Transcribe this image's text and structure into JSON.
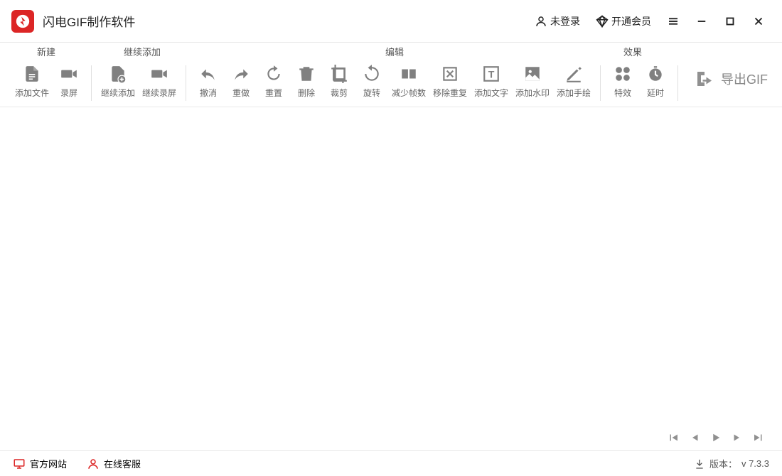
{
  "app": {
    "title": "闪电GIF制作软件"
  },
  "titlebar": {
    "login": "未登录",
    "vip": "开通会员"
  },
  "toolbar": {
    "headers": {
      "new": "新建",
      "continue": "继续添加",
      "edit": "编辑",
      "effect": "效果"
    },
    "new": {
      "addFile": "添加文件",
      "recordScreen": "录屏"
    },
    "continue": {
      "continueAdd": "继续添加",
      "continueRecord": "继续录屏"
    },
    "edit": {
      "undo": "撤消",
      "redo": "重做",
      "reset": "重置",
      "delete": "删除",
      "crop": "裁剪",
      "rotate": "旋转",
      "reduceFrames": "减少帧数",
      "removeDup": "移除重复",
      "addText": "添加文字",
      "addWatermark": "添加水印",
      "addDraw": "添加手绘"
    },
    "effect": {
      "fx": "特效",
      "delay": "延时"
    },
    "export": "导出GIF"
  },
  "statusbar": {
    "official": "官方网站",
    "service": "在线客服",
    "versionLabel": "版本：",
    "version": "v 7.3.3"
  }
}
